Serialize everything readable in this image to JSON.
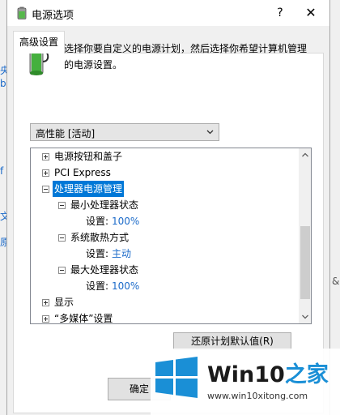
{
  "window": {
    "title": "电源选项",
    "help": "?",
    "close": "✕"
  },
  "background": {
    "left_fragments": [
      "央",
      "b",
      "f",
      "文",
      "原"
    ],
    "right_fragments": [
      "&"
    ]
  },
  "tab": {
    "label": "高级设置"
  },
  "description": "选择你要自定义的电源计划，然后选择你希望计算机管理的电源设置。",
  "plan_select": {
    "value": "高性能 [活动]"
  },
  "tree": [
    {
      "label": "电源按钮和盖子",
      "expander": "plus"
    },
    {
      "label": "PCI Express",
      "expander": "plus"
    },
    {
      "label": "处理器电源管理",
      "expander": "minus",
      "selected": true
    },
    {
      "label": "最小处理器状态",
      "expander": "minus"
    },
    {
      "setting_label": "设置:",
      "value": "100%"
    },
    {
      "label": "系统散热方式",
      "expander": "minus"
    },
    {
      "setting_label": "设置:",
      "value": "主动"
    },
    {
      "label": "最大处理器状态",
      "expander": "minus"
    },
    {
      "setting_label": "设置:",
      "value": "100%"
    },
    {
      "label": "显示",
      "expander": "plus"
    },
    {
      "label": "“多媒体”设置",
      "expander": "plus"
    }
  ],
  "buttons": {
    "restore": "还原计划默认值(R)",
    "ok": "确定"
  },
  "watermark": {
    "brand_a": "Win10",
    "brand_b": "之家",
    "url": "www.win10xitong.com"
  },
  "colors": {
    "selection": "#0078d7",
    "value_text": "#1b6ac9",
    "logo_blue": "#1a8fd6"
  }
}
